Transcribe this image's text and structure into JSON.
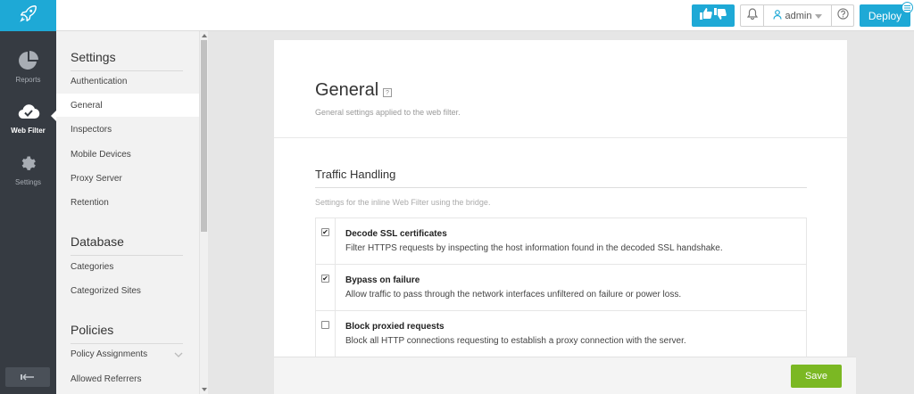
{
  "rail": {
    "items": [
      {
        "label": "Reports",
        "icon": "pie-chart-icon"
      },
      {
        "label": "Web Filter",
        "icon": "cloud-check-icon",
        "active": true
      },
      {
        "label": "Settings",
        "icon": "gear-icon"
      }
    ]
  },
  "topbar": {
    "user": "admin",
    "deploy_label": "Deploy"
  },
  "subnav": {
    "sections": [
      {
        "heading": "Settings",
        "items": [
          "Authentication",
          "General",
          "Inspectors",
          "Mobile Devices",
          "Proxy Server",
          "Retention"
        ]
      },
      {
        "heading": "Database",
        "items": [
          "Categories",
          "Categorized Sites"
        ]
      },
      {
        "heading": "Policies",
        "items": [
          "Policy Assignments",
          "Allowed Referrers"
        ]
      }
    ],
    "active_item": "General"
  },
  "main": {
    "title": "General",
    "help_glyph": "?",
    "subtitle": "General settings applied to the web filter.",
    "section_title": "Traffic Handling",
    "section_subtitle": "Settings for the inline Web Filter using the bridge.",
    "options": [
      {
        "title": "Decode SSL certificates",
        "desc": "Filter HTTPS requests by inspecting the host information found in the decoded SSL handshake.",
        "checked": true
      },
      {
        "title": "Bypass on failure",
        "desc": "Allow traffic to pass through the network interfaces unfiltered on failure or power loss.",
        "checked": true
      },
      {
        "title": "Block proxied requests",
        "desc": "Block all HTTP connections requesting to establish a proxy connection with the server.",
        "checked": false
      }
    ],
    "save_label": "Save"
  },
  "colors": {
    "accent": "#1ea9d6",
    "rail": "#363b42",
    "save": "#7bb823"
  }
}
